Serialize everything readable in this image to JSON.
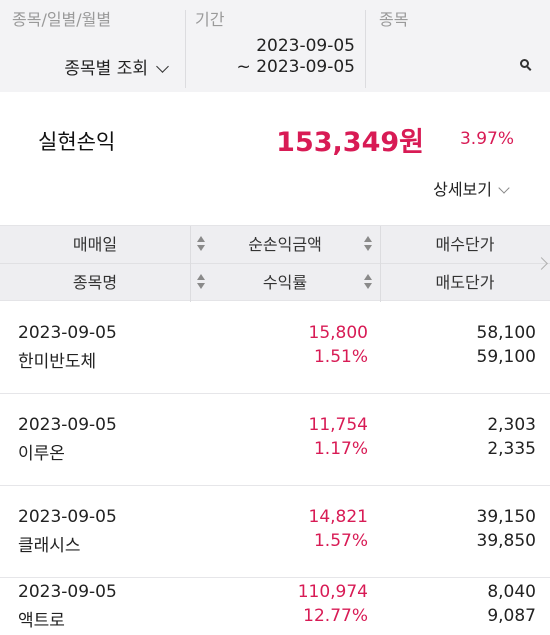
{
  "filter": {
    "col1": {
      "label": "종목/일별/월별",
      "value": "종목별 조회"
    },
    "col2": {
      "label": "기간",
      "date_from": "2023-09-05",
      "date_to": "~ 2023-09-05"
    },
    "col3": {
      "label": "종목"
    }
  },
  "summary": {
    "label": "실현손익",
    "amount": "153,349원",
    "rate": "3.97%",
    "detail_label": "상세보기"
  },
  "table": {
    "headers_row1": [
      "매매일",
      "순손익금액",
      "매수단가"
    ],
    "headers_row2": [
      "종목명",
      "수익률",
      "매도단가"
    ],
    "rows": [
      {
        "date": "2023-09-05",
        "name": "한미반도체",
        "profit": "15,800",
        "rate": "1.51%",
        "buy_price": "58,100",
        "sell_price": "59,100"
      },
      {
        "date": "2023-09-05",
        "name": "이루온",
        "profit": "11,754",
        "rate": "1.17%",
        "buy_price": "2,303",
        "sell_price": "2,335"
      },
      {
        "date": "2023-09-05",
        "name": "클래시스",
        "profit": "14,821",
        "rate": "1.57%",
        "buy_price": "39,150",
        "sell_price": "39,850"
      },
      {
        "date": "2023-09-05",
        "name": "액트로",
        "profit": "110,974",
        "rate": "12.77%",
        "buy_price": "8,040",
        "sell_price": "9,087"
      }
    ]
  },
  "colors": {
    "accent": "#d81b55",
    "header_bg": "#eeeef1",
    "filter_bg": "#f3f3f5"
  }
}
